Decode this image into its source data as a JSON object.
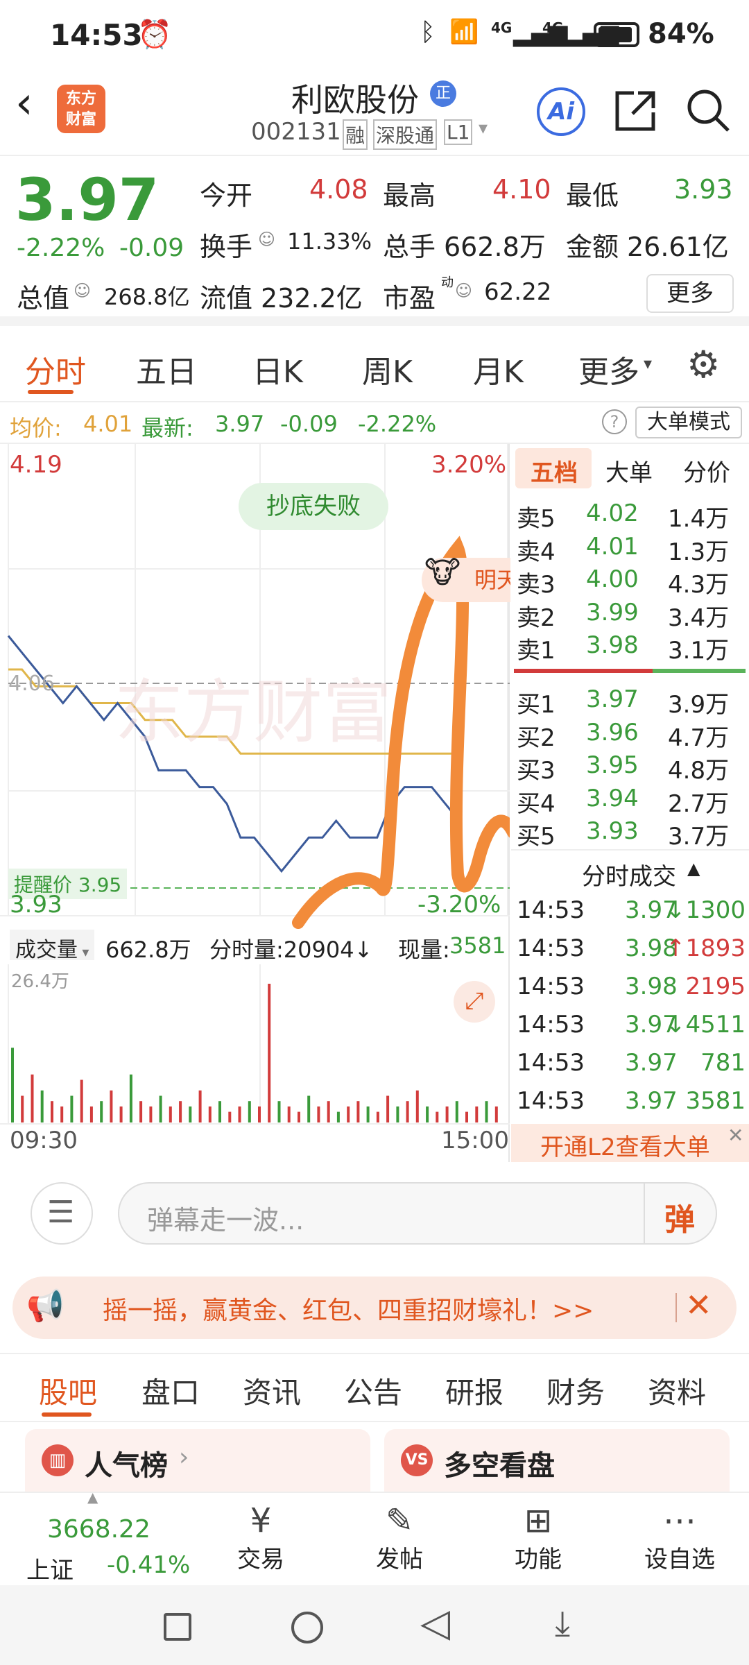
{
  "status": {
    "time": "14:53",
    "battery": "84%",
    "net1": "4G",
    "net2": "4G"
  },
  "header": {
    "title": "利欧股份",
    "badge": "正",
    "code": "002131",
    "tags": [
      "融",
      "深股通",
      "L1"
    ],
    "logo": "东方\n财富",
    "ai": "Ai"
  },
  "quote": {
    "price": "3.97",
    "change_pct": "-2.22%",
    "change": "-0.09",
    "open_label": "今开",
    "open": "4.08",
    "high_label": "最高",
    "high": "4.10",
    "low_label": "最低",
    "low": "3.93",
    "turnover_label": "换手",
    "turnover": "11.33%",
    "volume_label": "总手",
    "volume": "662.8万",
    "amount_label": "金额",
    "amount": "26.61亿",
    "mktcap_label": "总值",
    "mktcap": "268.8亿",
    "float_label": "流值",
    "float": "232.2亿",
    "pe_label": "市盈",
    "pe_sup": "动",
    "pe": "62.22",
    "more_btn": "更多"
  },
  "tabs": [
    "分时",
    "五日",
    "日K",
    "周K",
    "月K",
    "更多"
  ],
  "infobar": {
    "avg_label": "均价:",
    "avg": "4.01",
    "last_label": "最新:",
    "last": "3.97",
    "chg": "-0.09",
    "pct": "-2.22%",
    "mode": "大单模式"
  },
  "chart": {
    "top_price": "4.19",
    "top_pct": "3.20%",
    "bottom_price": "3.93",
    "bottom_pct": "-3.20%",
    "mid_price": "4.06",
    "tag": "抄底失败",
    "alert_label": "提醒价 3.95",
    "mascot_text": "明天",
    "watermark": "东方财富",
    "vol_label": "成交量",
    "vol_value": "662.8万",
    "tick_vol": "分时量:20904↓",
    "cur_label": "现量:",
    "cur_vol": "3581",
    "vol_max": "26.4万",
    "time_start": "09:30",
    "time_end": "15:00"
  },
  "chart_data": {
    "type": "line",
    "x_range": [
      "09:30",
      "15:00"
    ],
    "ylim": [
      3.93,
      4.19
    ],
    "series": [
      {
        "name": "最新",
        "values": [
          4.08,
          4.07,
          4.06,
          4.05,
          4.04,
          4.05,
          4.04,
          4.03,
          4.04,
          4.03,
          4.02,
          4.0,
          4.0,
          4.0,
          3.99,
          3.99,
          3.98,
          3.96,
          3.96,
          3.95,
          3.94,
          3.95,
          3.96,
          3.96,
          3.97,
          3.96,
          3.96,
          3.96,
          3.98,
          3.99,
          3.99,
          3.99,
          3.98,
          3.97
        ]
      },
      {
        "name": "均价",
        "values": [
          4.06,
          4.06,
          4.05,
          4.05,
          4.05,
          4.05,
          4.04,
          4.04,
          4.04,
          4.04,
          4.03,
          4.03,
          4.03,
          4.02,
          4.02,
          4.02,
          4.02,
          4.01,
          4.01,
          4.01,
          4.01,
          4.01,
          4.01,
          4.01,
          4.01,
          4.01,
          4.01,
          4.01,
          4.01,
          4.01,
          4.01,
          4.01,
          4.01,
          4.01
        ]
      }
    ],
    "volume": [
      14,
      5,
      9,
      6,
      4,
      3,
      5,
      8,
      3,
      4,
      6,
      3,
      9,
      4,
      3,
      5,
      3,
      4,
      3,
      6,
      3,
      4,
      2,
      3,
      4,
      3,
      26,
      4,
      3,
      2,
      5,
      3,
      4,
      2,
      3,
      4,
      3,
      2,
      5,
      3,
      4,
      6,
      3,
      2,
      3,
      4,
      2,
      3,
      4,
      3
    ]
  },
  "order_book": {
    "tabs": [
      "五档",
      "大单",
      "分价"
    ],
    "asks": [
      {
        "label": "卖5",
        "price": "4.02",
        "vol": "1.4万"
      },
      {
        "label": "卖4",
        "price": "4.01",
        "vol": "1.3万"
      },
      {
        "label": "卖3",
        "price": "4.00",
        "vol": "4.3万"
      },
      {
        "label": "卖2",
        "price": "3.99",
        "vol": "3.4万"
      },
      {
        "label": "卖1",
        "price": "3.98",
        "vol": "3.1万"
      }
    ],
    "bids": [
      {
        "label": "买1",
        "price": "3.97",
        "vol": "3.9万"
      },
      {
        "label": "买2",
        "price": "3.96",
        "vol": "4.7万"
      },
      {
        "label": "买3",
        "price": "3.95",
        "vol": "4.8万"
      },
      {
        "label": "买4",
        "price": "3.94",
        "vol": "2.7万"
      },
      {
        "label": "买5",
        "price": "3.93",
        "vol": "3.7万"
      }
    ],
    "trades_title": "分时成交",
    "trades": [
      {
        "time": "14:53",
        "price": "3.97",
        "vol": "↓1300",
        "color": "green"
      },
      {
        "time": "14:53",
        "price": "3.98",
        "vol": "↑1893",
        "color": "red"
      },
      {
        "time": "14:53",
        "price": "3.98",
        "vol": "2195",
        "color": "red"
      },
      {
        "time": "14:53",
        "price": "3.97",
        "vol": "↓4511",
        "color": "green"
      },
      {
        "time": "14:53",
        "price": "3.97",
        "vol": "781",
        "color": "green"
      },
      {
        "time": "14:53",
        "price": "3.97",
        "vol": "3581",
        "color": "green"
      }
    ],
    "l2_promo": "开通L2查看大单"
  },
  "danmaku": {
    "placeholder": "弹幕走一波...",
    "btn": "弹"
  },
  "banner": {
    "text": "摇一摇，赢黄金、红包、四重招财壕礼！>>"
  },
  "bottom_tabs": [
    "股吧",
    "盘口",
    "资讯",
    "公告",
    "研报",
    "财务",
    "资料"
  ],
  "cards": [
    {
      "label": "人气榜"
    },
    {
      "label": "多空看盘"
    }
  ],
  "nav": {
    "index_value": "3668.22",
    "index_name": "上证",
    "index_pct": "-0.41%",
    "items": [
      "交易",
      "发帖",
      "功能",
      "设自选"
    ]
  },
  "colors": {
    "red": "#d23b3b",
    "green": "#3a9a3a",
    "orange": "#f28b3a",
    "line": "#3b5a9a",
    "avg": "#e0b64a"
  }
}
